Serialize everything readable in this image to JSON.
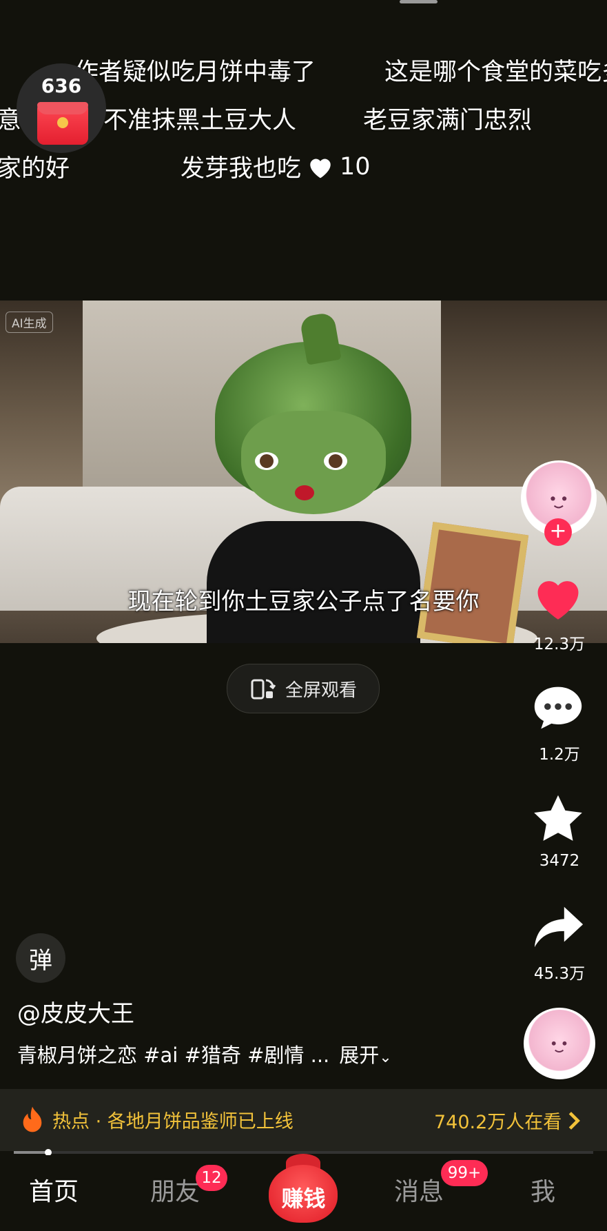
{
  "danmaku": [
    {
      "text": "作者疑似吃月饼中毒了"
    },
    {
      "text": "这是哪个食堂的菜吃多"
    },
    {
      "text": "意"
    },
    {
      "text": "不准抹黑土豆大人"
    },
    {
      "text": "老豆家满门忠烈"
    },
    {
      "text": "家的好"
    },
    {
      "text": "发芽我也吃",
      "likes": "10"
    }
  ],
  "red_packet": {
    "count": "636"
  },
  "video": {
    "ai_tag": "AI生成",
    "subtitle": "现在轮到你土豆家公子点了名要你"
  },
  "fullscreen_button": {
    "label": "全屏观看"
  },
  "actions": {
    "likes": "12.3万",
    "comments": "1.2万",
    "favorites": "3472",
    "shares": "45.3万"
  },
  "danmu_toggle": {
    "label": "弹"
  },
  "post": {
    "author": "@皮皮大王",
    "description": "青椒月饼之恋 #ai #猎奇 #剧情 ...",
    "expand": "展开"
  },
  "hot": {
    "topic": "热点 · 各地月饼品鉴师已上线",
    "viewers": "740.2万人在看"
  },
  "progress": {
    "fraction": 0.06
  },
  "tabs": {
    "home": "首页",
    "friends": "朋友",
    "friends_badge": "12",
    "earn": "赚钱",
    "messages": "消息",
    "messages_badge": "99+",
    "me": "我"
  },
  "colors": {
    "accent": "#fe2c55",
    "hot": "#f2c23a",
    "background": "#12120c"
  }
}
